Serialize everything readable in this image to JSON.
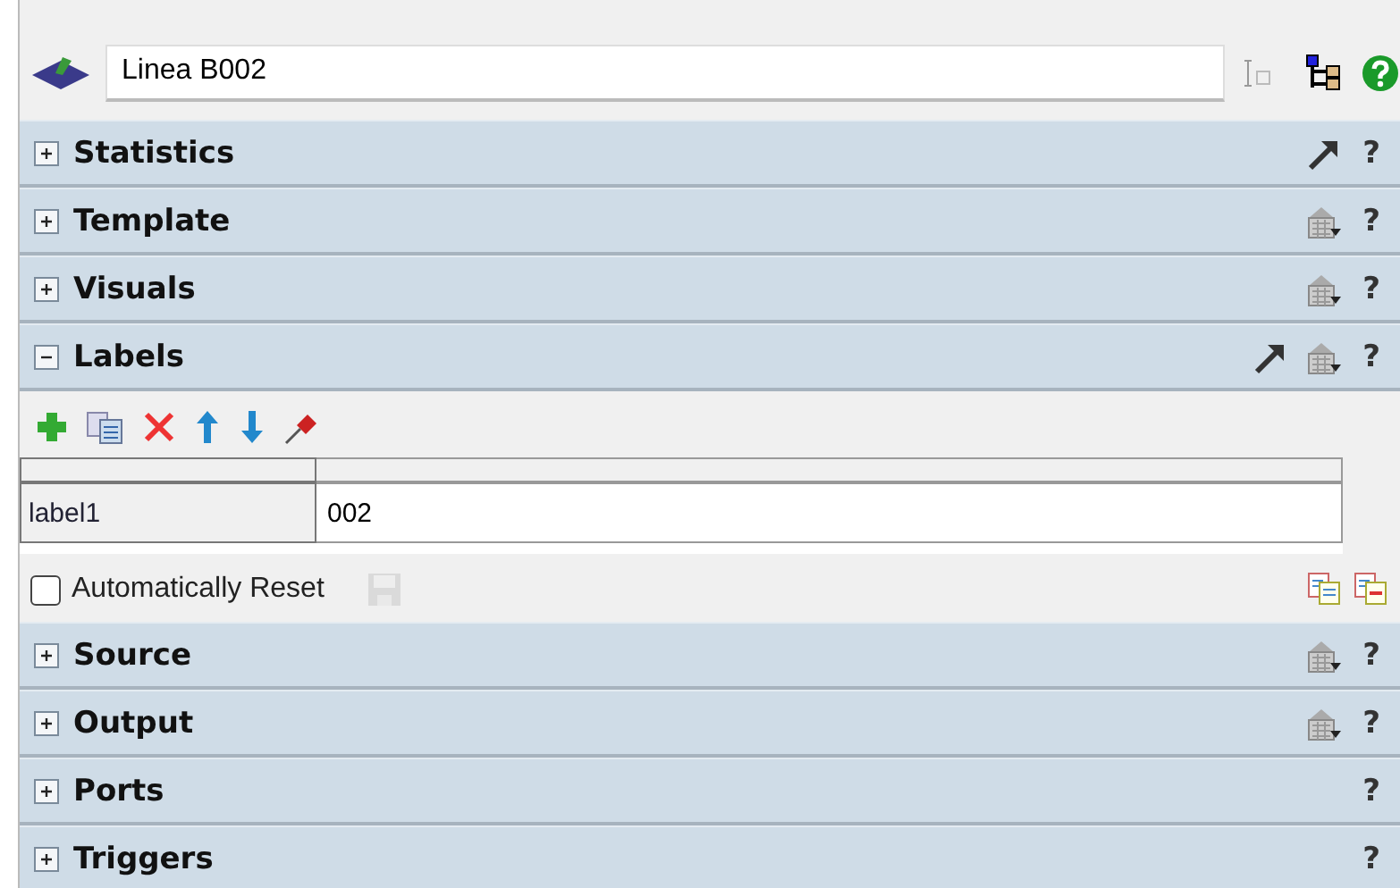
{
  "object_name": {
    "value": "Linea B002"
  },
  "sections": [
    {
      "title": "Statistics",
      "expanded": false,
      "has_link": true,
      "has_options": false,
      "help": "?"
    },
    {
      "title": "Template",
      "expanded": false,
      "has_link": false,
      "has_options": true,
      "help": "?"
    },
    {
      "title": "Visuals",
      "expanded": false,
      "has_link": false,
      "has_options": true,
      "help": "?"
    },
    {
      "title": "Labels",
      "expanded": true,
      "has_link": true,
      "has_options": true,
      "help": "?"
    },
    {
      "title": "Source",
      "expanded": false,
      "has_link": false,
      "has_options": true,
      "help": "?"
    },
    {
      "title": "Output",
      "expanded": false,
      "has_link": false,
      "has_options": true,
      "help": "?"
    },
    {
      "title": "Ports",
      "expanded": false,
      "has_link": false,
      "has_options": false,
      "help": "?"
    },
    {
      "title": "Triggers",
      "expanded": false,
      "has_link": false,
      "has_options": false,
      "help": "?"
    }
  ],
  "labels": {
    "rows": [
      {
        "name": "label1",
        "value": "002"
      }
    ],
    "auto_reset": {
      "label": "Automatically Reset",
      "checked": false
    },
    "save_disabled": true
  }
}
